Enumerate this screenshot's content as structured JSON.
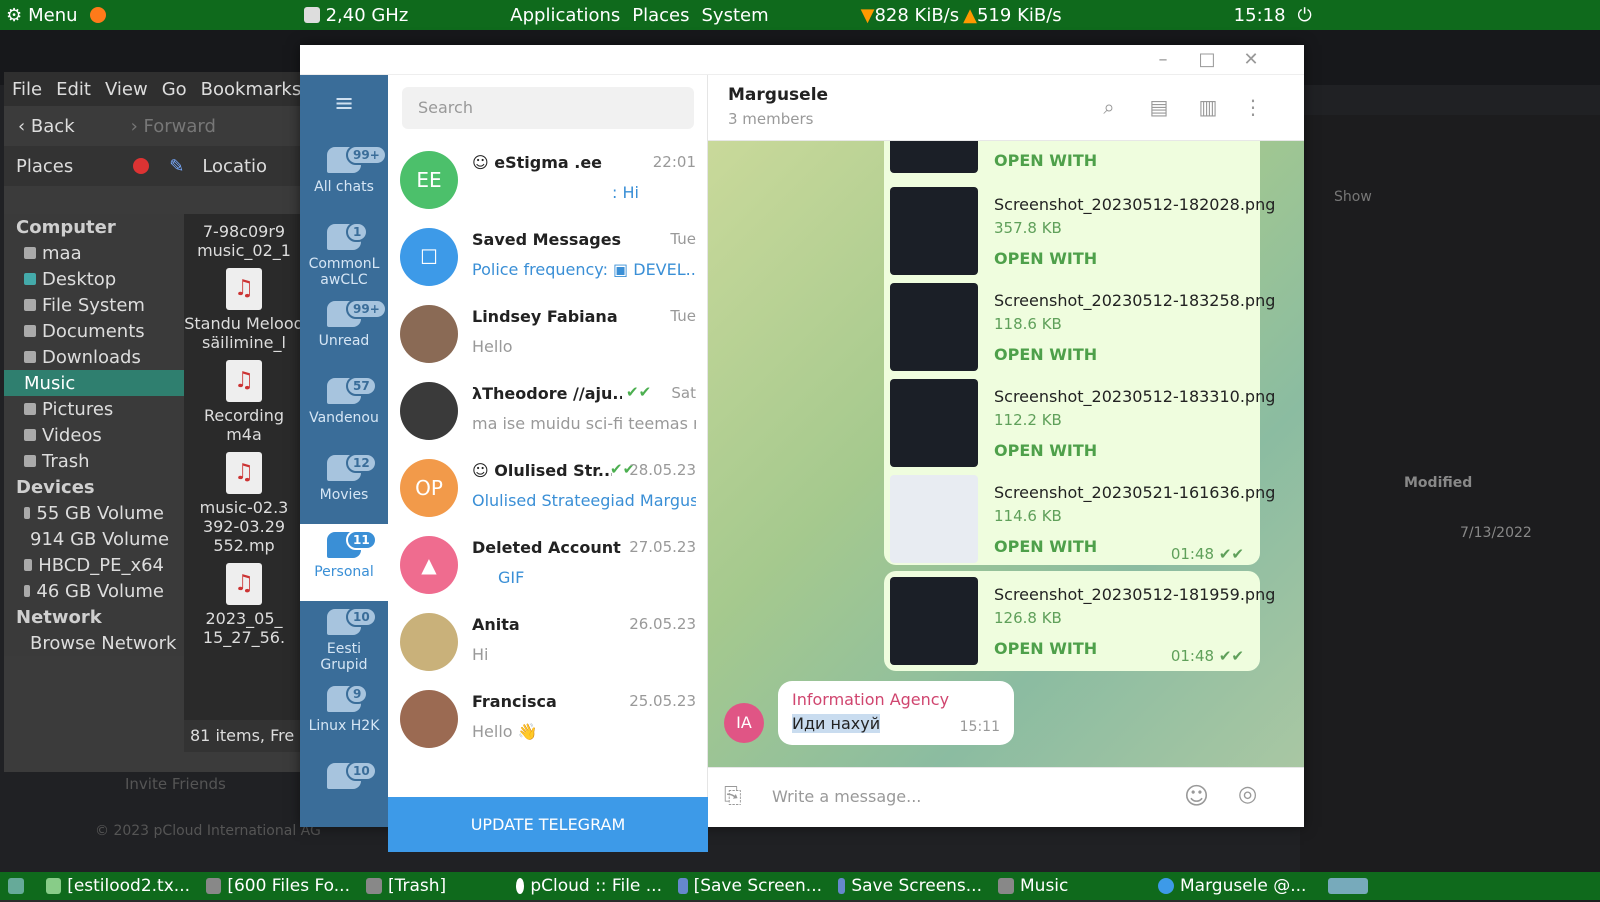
{
  "topbar": {
    "menu": "Menu",
    "cpu": "2,40 GHz",
    "applications": "Applications",
    "places": "Places",
    "system": "System",
    "down": "828 KiB/s",
    "up": "519 KiB/s",
    "clock": "15:18"
  },
  "filemanager": {
    "menu": [
      "File",
      "Edit",
      "View",
      "Go",
      "Bookmarks"
    ],
    "back": "Back",
    "forward": "Forward",
    "places": "Places",
    "location": "Locatio",
    "computer_header": "Computer",
    "computer_items": [
      "maa",
      "Desktop",
      "File System",
      "Documents",
      "Downloads",
      "Music",
      "Pictures",
      "Videos",
      "Trash"
    ],
    "devices_header": "Devices",
    "devices_items": [
      "55 GB Volume",
      "914 GB Volume",
      "HBCD_PE_x64",
      "46 GB Volume"
    ],
    "network_header": "Network",
    "network_items": [
      "Browse Network"
    ],
    "files": [
      "7-98c09r9 music_02_1",
      "Standu Melood säilimine_l",
      "Recording m4a",
      "music-02.3 392-03.29 552.mp",
      "2023_05_ 15_27_56."
    ],
    "status": "81 items, Fre"
  },
  "telegram": {
    "search_placeholder": "Search",
    "folders": [
      {
        "label": "All chats",
        "badge": "99+"
      },
      {
        "label": "CommonLawCLC",
        "badge": "1"
      },
      {
        "label": "Unread",
        "badge": "99+"
      },
      {
        "label": "Vandenou",
        "badge": "57"
      },
      {
        "label": "Movies",
        "badge": "12"
      },
      {
        "label": "Personal",
        "badge": "11"
      },
      {
        "label": "Eesti Grupid",
        "badge": "10"
      },
      {
        "label": "Linux H2K",
        "badge": "9"
      },
      {
        "label": "",
        "badge": "10"
      }
    ],
    "chats": [
      {
        "initials": "EE",
        "name": "eStigma .ee",
        "time": "22:01",
        "msg": ": Hi",
        "color": "#4cc06b"
      },
      {
        "initials": "",
        "name": "Saved Messages",
        "time": "Tue",
        "msg": "Police frequency: ▣ DEVEL...",
        "color": "#3d9ae8"
      },
      {
        "initials": "",
        "name": "Lindsey Fabiana",
        "time": "Tue",
        "msg": "Hello",
        "color": "#8a6a55"
      },
      {
        "initials": "",
        "name": "λTheodore //aju...",
        "time": "Sat",
        "msg": "ma ise muidu sci-fi teemas r...",
        "color": "#3a3a3a"
      },
      {
        "initials": "OP",
        "name": "Olulised Str...",
        "time": "28.05.23",
        "msg": "Olulised Strateegiad Margus ...",
        "color": "#f29a4a"
      },
      {
        "initials": "",
        "name": "Deleted Account",
        "time": "27.05.23",
        "msg": "GIF",
        "color": "#ef6c8f"
      },
      {
        "initials": "",
        "name": "Anita",
        "time": "26.05.23",
        "msg": "Hi",
        "color": "#c9b17a"
      },
      {
        "initials": "",
        "name": "Francisca",
        "time": "25.05.23",
        "msg": "Hello 👋",
        "color": "#9b6a52"
      }
    ],
    "update_label": "UPDATE TELEGRAM",
    "chat_title": "Margusele",
    "chat_subtitle": "3 members",
    "files": [
      {
        "name": "",
        "size": "",
        "open": "OPEN WITH"
      },
      {
        "name": "Screenshot_20230512-182028.png",
        "size": "357.8 KB",
        "open": "OPEN WITH"
      },
      {
        "name": "Screenshot_20230512-183258.png",
        "size": "118.6 KB",
        "open": "OPEN WITH"
      },
      {
        "name": "Screenshot_20230512-183310.png",
        "size": "112.2 KB",
        "open": "OPEN WITH"
      },
      {
        "name": "Screenshot_20230521-161636.png",
        "size": "114.6 KB",
        "open": "OPEN WITH",
        "time": "01:48"
      }
    ],
    "file2": {
      "name": "Screenshot_20230512-181959.png",
      "size": "126.8 KB",
      "open": "OPEN WITH",
      "time": "01:48"
    },
    "incoming": {
      "avatar": "IA",
      "sender": "Information Agency",
      "text": "Иди нахуй",
      "time": "15:11"
    },
    "compose_placeholder": "Write a message..."
  },
  "bg_browser": {
    "show": "Show",
    "modified": "Modified",
    "date": "7/13/2022",
    "invite": "Invite Friends",
    "copyright": "© 2023 pCloud International AG"
  },
  "taskbar": [
    "[estilood2.tx...",
    "[600 Files Fo...",
    "[Trash]",
    "pCloud :: File ...",
    "[Save Screen...",
    "Save Screens...",
    "Music",
    "Margusele @..."
  ]
}
